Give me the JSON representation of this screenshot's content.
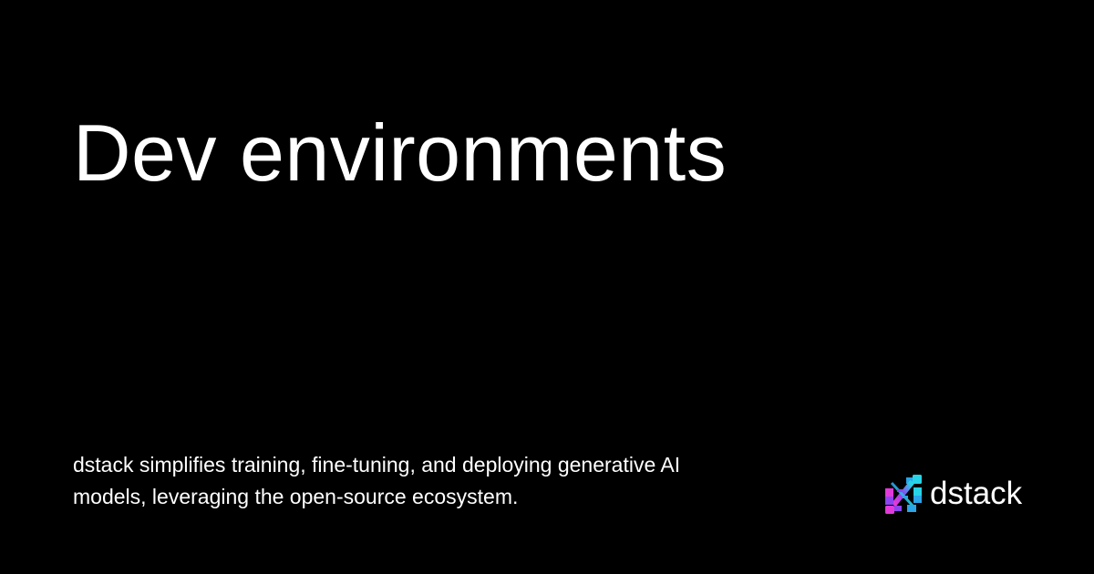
{
  "title": "Dev environments",
  "description": "dstack simplifies training, fine-tuning, and deploying generative AI models, leveraging the open-source ecosystem.",
  "brand": {
    "name": "dstack",
    "icon": "dstack-logo-icon"
  },
  "colors": {
    "background": "#000000",
    "text": "#ffffff",
    "logo_pink": "#e13ad9",
    "logo_purple": "#8b44f0",
    "logo_blue": "#2ba4e8",
    "logo_cyan": "#27d3e6"
  }
}
